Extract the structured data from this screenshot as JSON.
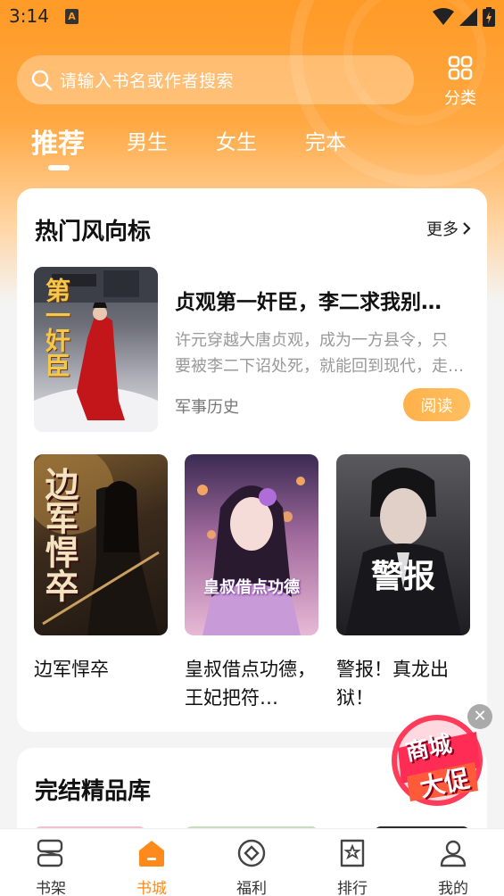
{
  "status_bar": {
    "time": "3:14",
    "app_badge": "A"
  },
  "search": {
    "placeholder": "请输入书名或作者搜索"
  },
  "category_button": {
    "label": "分类"
  },
  "tabs": [
    {
      "label": "推荐",
      "active": true
    },
    {
      "label": "男生",
      "active": false
    },
    {
      "label": "女生",
      "active": false
    },
    {
      "label": "完本",
      "active": false
    }
  ],
  "hot_section": {
    "title": "热门风向标",
    "more_label": "更多",
    "featured": {
      "title": "贞观第一奸臣，李二求我别…",
      "desc_line1": "许元穿越大唐贞观，成为一方县令，只",
      "desc_line2": "要被李二下诏处死，就能回到现代，走…",
      "tag": "军事历史",
      "read_label": "阅读",
      "cover_text": "第一奸臣"
    },
    "books": [
      {
        "title": "边军悍卒",
        "cover_text": "边军悍卒"
      },
      {
        "title": "皇叔借点功德，王妃把符…",
        "cover_text": "皇叔借点功德"
      },
      {
        "title": "警报！真龙出狱！",
        "cover_text": "警报"
      }
    ]
  },
  "complete_section": {
    "title": "完结精品库"
  },
  "promo": {
    "text_line1": "商城",
    "text_line2": "大促"
  },
  "bottom_nav": [
    {
      "label": "书架",
      "icon": "bookshelf-icon",
      "active": false
    },
    {
      "label": "书城",
      "icon": "bookstore-icon",
      "active": true
    },
    {
      "label": "福利",
      "icon": "welfare-icon",
      "active": false
    },
    {
      "label": "排行",
      "icon": "ranking-icon",
      "active": false
    },
    {
      "label": "我的",
      "icon": "profile-icon",
      "active": false
    }
  ],
  "colors": {
    "accent": "#ff9a26",
    "active_nav": "#ff8a1c",
    "read_button": "#ffb14a"
  }
}
